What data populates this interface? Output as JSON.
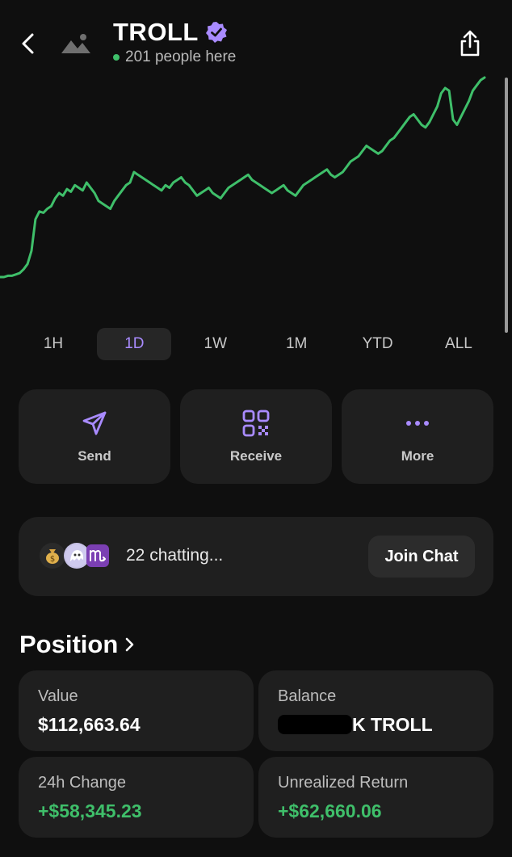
{
  "header": {
    "title": "TROLL",
    "presence_text": "201 people here",
    "icons": {
      "back": "chevron-left-icon",
      "token": "image-placeholder-icon",
      "verified": "verified-badge-icon",
      "share": "share-icon"
    }
  },
  "colors": {
    "accent": "#a98bff",
    "positive": "#3fbf6a",
    "card": "#1f1f1f",
    "background": "#0f0f0f"
  },
  "chart_data": {
    "type": "line",
    "series": [
      {
        "values": [
          8,
          8,
          9,
          9,
          10,
          11,
          14,
          18,
          28,
          52,
          58,
          57,
          60,
          62,
          68,
          72,
          70,
          75,
          73,
          78,
          76,
          74,
          80,
          76,
          72,
          66,
          64,
          62,
          60,
          66,
          70,
          74,
          78,
          80,
          88,
          86,
          84,
          82,
          80,
          78,
          76,
          74,
          78,
          76,
          80,
          82,
          84,
          80,
          78,
          74,
          70,
          72,
          74,
          76,
          72,
          70,
          68,
          72,
          76,
          78,
          80,
          82,
          84,
          86,
          82,
          80,
          78,
          76,
          74,
          72,
          74,
          76,
          78,
          74,
          72,
          70,
          74,
          78,
          80,
          82,
          84,
          86,
          88,
          90,
          86,
          84,
          86,
          88,
          92,
          96,
          98,
          100,
          104,
          108,
          106,
          104,
          102,
          104,
          108,
          112,
          114,
          118,
          122,
          126,
          130,
          132,
          128,
          124,
          122,
          126,
          132,
          138,
          148,
          152,
          150,
          128,
          124,
          130,
          136,
          142,
          150,
          154,
          158,
          160
        ]
      }
    ]
  },
  "ranges": [
    {
      "label": "1H"
    },
    {
      "label": "1D"
    },
    {
      "label": "1W"
    },
    {
      "label": "1M"
    },
    {
      "label": "YTD"
    },
    {
      "label": "ALL"
    }
  ],
  "active_range": "1D",
  "actions": [
    {
      "label": "Send",
      "icon": "send-icon"
    },
    {
      "label": "Receive",
      "icon": "qr-code-icon"
    },
    {
      "label": "More",
      "icon": "more-dots-icon"
    }
  ],
  "chat": {
    "text": "22 chatting...",
    "join_label": "Join Chat",
    "avatars": [
      "money-bag-emoji",
      "ghost-avatar",
      "scorpio-emoji"
    ]
  },
  "position": {
    "title": "Position",
    "cells": [
      {
        "label": "Value",
        "value": "$112,663.64"
      },
      {
        "label": "Balance",
        "value": "K TROLL"
      },
      {
        "label": "24h Change",
        "value": "+$58,345.23"
      },
      {
        "label": "Unrealized Return",
        "value": "+$62,660.06"
      }
    ]
  }
}
